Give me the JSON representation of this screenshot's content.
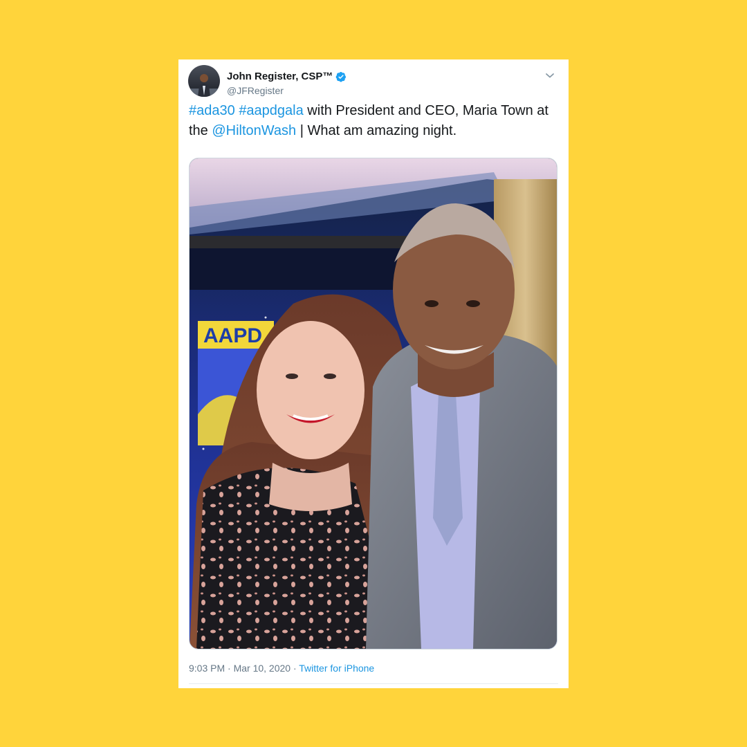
{
  "tweet": {
    "author": {
      "display_name": "John Register, CSP™",
      "handle": "@JFRegister",
      "avatar_icon": "user-avatar",
      "verified_icon": "verified-badge-icon"
    },
    "menu_icon": "chevron-down-icon",
    "text": {
      "hashtag1": "#ada30",
      "space1": " ",
      "hashtag2": "#aapdgala",
      "middle": " with President and CEO, Maria Town at the ",
      "mention": "@HiltonWash",
      "end": " | What am amazing night."
    },
    "media": {
      "banner_text": "AAPD"
    },
    "timestamp": "9:03 PM · Mar 10, 2020",
    "separator": " · ",
    "source": "Twitter for iPhone"
  },
  "colors": {
    "background": "#FFD43B",
    "card": "#ffffff",
    "link": "#1b95e0",
    "text": "#14171a",
    "secondary_text": "#657786",
    "verified": "#1da1f2"
  }
}
